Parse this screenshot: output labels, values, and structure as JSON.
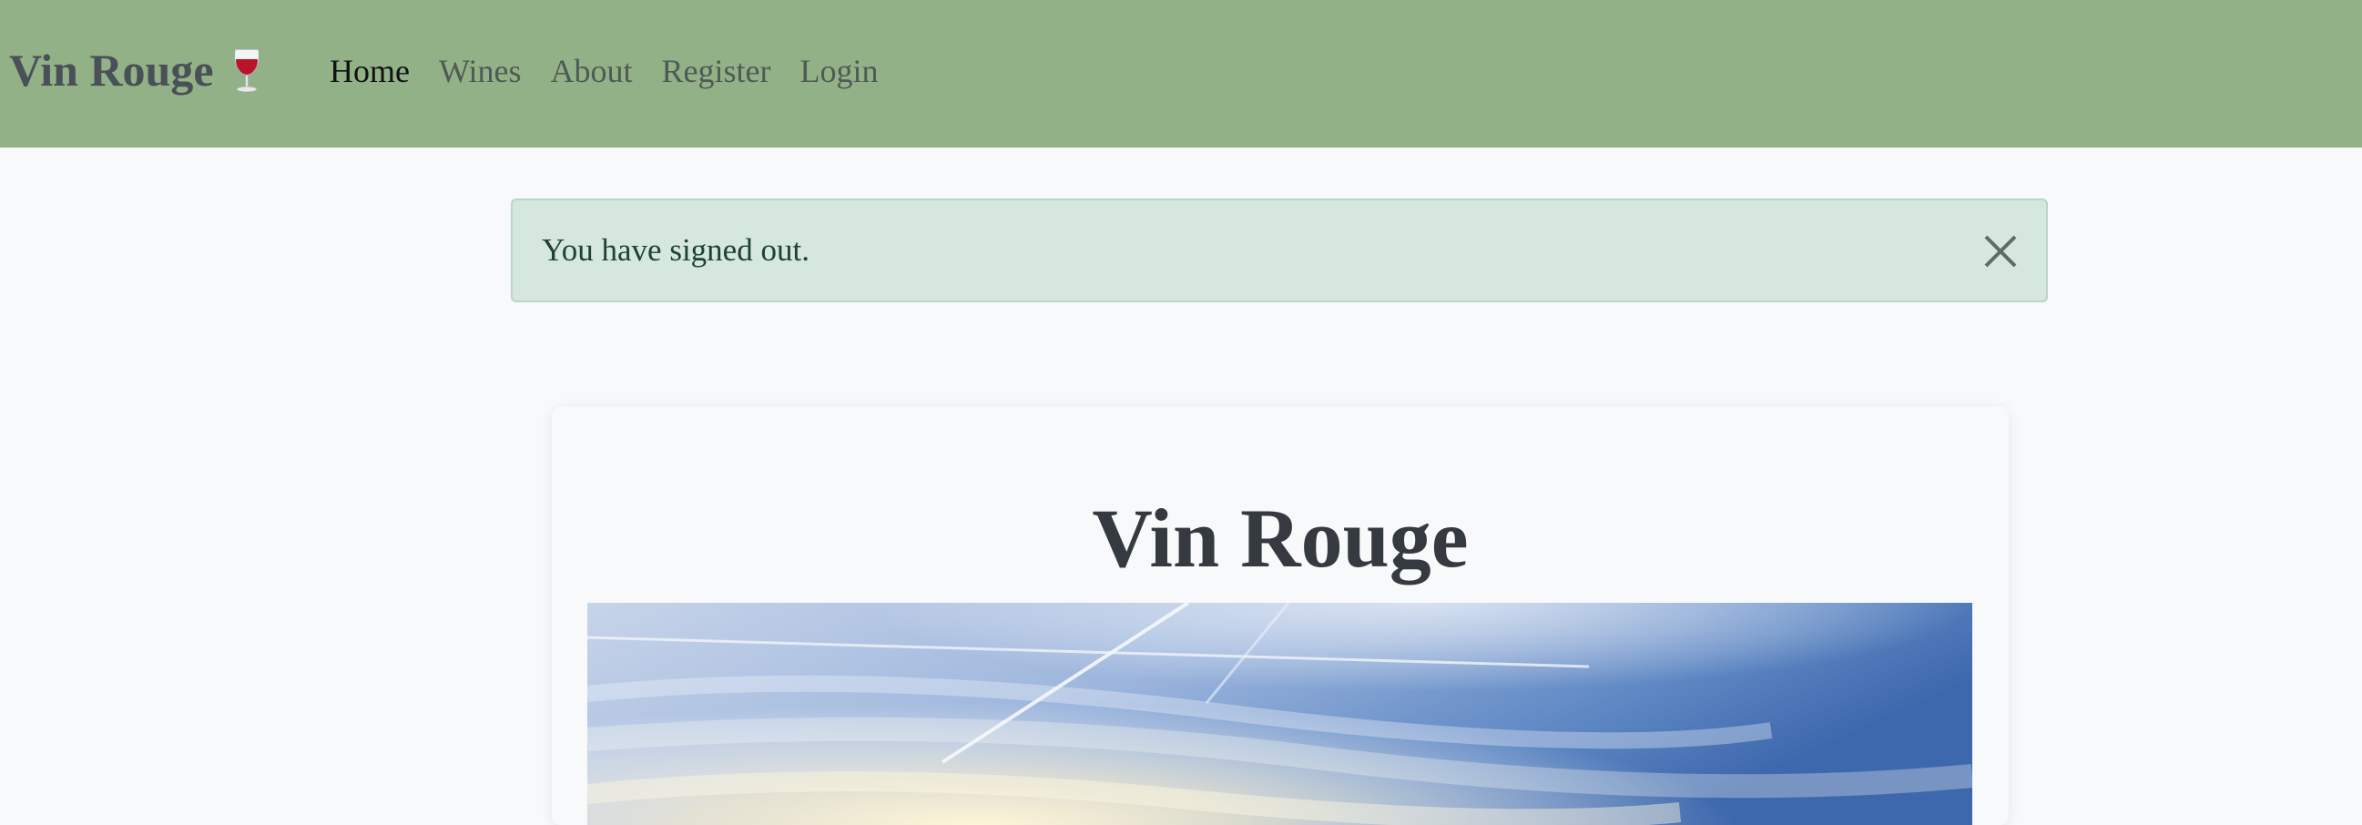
{
  "navbar": {
    "brand": "Vin Rouge",
    "brand_icon": "wine-glass-icon",
    "background_color": "#92b187",
    "links": [
      {
        "label": "Home",
        "active": true
      },
      {
        "label": "Wines",
        "active": false
      },
      {
        "label": "About",
        "active": false
      },
      {
        "label": "Register",
        "active": false
      },
      {
        "label": "Login",
        "active": false
      }
    ]
  },
  "alert": {
    "message": "You have signed out.",
    "close_icon": "close-icon",
    "background_color": "#d5e7de"
  },
  "card": {
    "title": "Vin Rouge",
    "image": "sky-sunrise-image"
  }
}
